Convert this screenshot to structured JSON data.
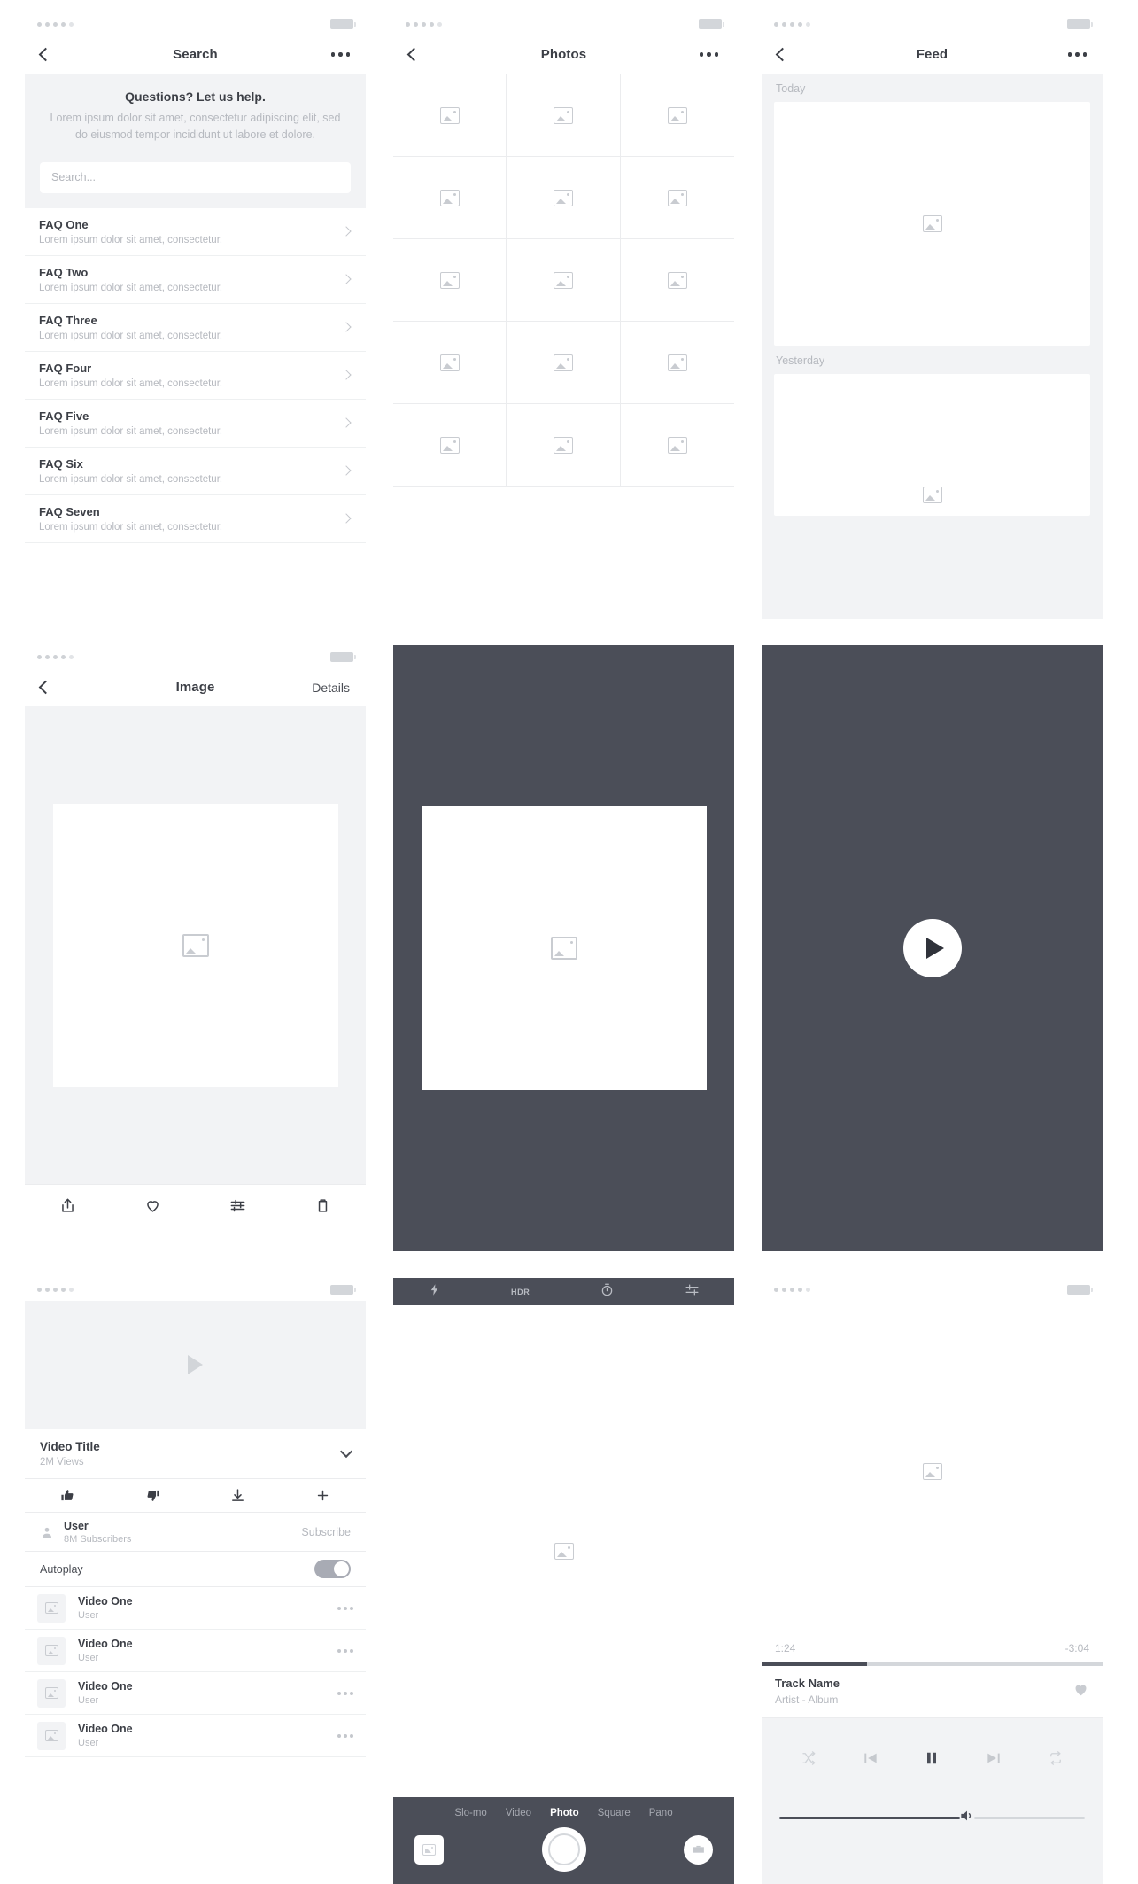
{
  "screens": {
    "search": {
      "nav": {
        "title": "Search",
        "back_icon": "chevron-left-icon",
        "more_icon": "more-horizontal-icon"
      },
      "help": {
        "title": "Questions? Let us help.",
        "body": "Lorem ipsum dolor sit amet, consectetur adipiscing elit, sed do eiusmod tempor incididunt ut labore et dolore."
      },
      "search_placeholder": "Search...",
      "faq": [
        {
          "question": "FAQ One",
          "answer": "Lorem ipsum dolor sit amet, consectetur."
        },
        {
          "question": "FAQ Two",
          "answer": "Lorem ipsum dolor sit amet, consectetur."
        },
        {
          "question": "FAQ Three",
          "answer": "Lorem ipsum dolor sit amet, consectetur."
        },
        {
          "question": "FAQ Four",
          "answer": "Lorem ipsum dolor sit amet, consectetur."
        },
        {
          "question": "FAQ Five",
          "answer": "Lorem ipsum dolor sit amet, consectetur."
        },
        {
          "question": "FAQ Six",
          "answer": "Lorem ipsum dolor sit amet, consectetur."
        },
        {
          "question": "FAQ Seven",
          "answer": "Lorem ipsum dolor sit amet, consectetur."
        }
      ]
    },
    "photos": {
      "nav": {
        "title": "Photos",
        "back_icon": "chevron-left-icon",
        "more_icon": "more-horizontal-icon"
      },
      "cell_count": 15,
      "cell_icon": "image-placeholder-icon"
    },
    "feed": {
      "nav": {
        "title": "Feed",
        "back_icon": "chevron-left-icon",
        "more_icon": "more-horizontal-icon"
      },
      "sections": [
        {
          "label": "Today"
        },
        {
          "label": "Yesterday"
        }
      ],
      "card_icon": "image-placeholder-icon"
    },
    "image_detail": {
      "nav": {
        "title": "Image",
        "back_icon": "chevron-left-icon",
        "right_action": "Details"
      },
      "toolbar": [
        {
          "name": "share-icon",
          "label": "Share"
        },
        {
          "name": "heart-icon",
          "label": "Favorite"
        },
        {
          "name": "adjust-icon",
          "label": "Adjust"
        },
        {
          "name": "trash-icon",
          "label": "Delete"
        }
      ]
    },
    "lightbox": {
      "image_icon": "image-placeholder-icon"
    },
    "video_player": {
      "play_icon": "play-icon"
    },
    "video_detail": {
      "preview_icon": "play-triangle-icon",
      "title": "Video Title",
      "views": "2M Views",
      "collapse_icon": "chevron-down-icon",
      "actions": [
        {
          "name": "thumbs-up-icon",
          "label": "Like"
        },
        {
          "name": "thumbs-down-icon",
          "label": "Dislike"
        },
        {
          "name": "download-icon",
          "label": "Download"
        },
        {
          "name": "plus-icon",
          "label": "Add to"
        }
      ],
      "channel": {
        "name": "User",
        "subscribers": "8M Subscribers",
        "action": "Subscribe",
        "avatar_icon": "person-icon"
      },
      "autoplay": {
        "label": "Autoplay",
        "on": true
      },
      "list": [
        {
          "title": "Video One",
          "user": "User"
        },
        {
          "title": "Video One",
          "user": "User"
        },
        {
          "title": "Video One",
          "user": "User"
        },
        {
          "title": "Video One",
          "user": "User"
        }
      ],
      "list_more_icon": "more-horizontal-icon"
    },
    "camera": {
      "top": [
        {
          "name": "flash-icon",
          "label": ""
        },
        {
          "name": "hdr-label",
          "label": "HDR"
        },
        {
          "name": "timer-icon",
          "label": ""
        },
        {
          "name": "settings-sliders-icon",
          "label": ""
        }
      ],
      "modes": [
        "Slo-mo",
        "Video",
        "Photo",
        "Square",
        "Pano"
      ],
      "active_mode": "Photo",
      "gallery_icon": "image-placeholder-icon",
      "shutter_icon": "shutter-button",
      "flip_icon": "camera-flip-icon"
    },
    "music": {
      "art_icon": "image-placeholder-icon",
      "elapsed": "1:24",
      "remaining": "-3:04",
      "progress_percent": 31,
      "track_name": "Track Name",
      "track_artist": "Artist - Album",
      "favorite_icon": "heart-filled-icon",
      "controls": [
        {
          "name": "shuffle-icon",
          "label": "Shuffle"
        },
        {
          "name": "previous-icon",
          "label": "Previous"
        },
        {
          "name": "pause-icon",
          "label": "Pause"
        },
        {
          "name": "next-icon",
          "label": "Next"
        },
        {
          "name": "repeat-icon",
          "label": "Repeat"
        }
      ],
      "volume_percent": 59,
      "volume_icon": "volume-icon"
    }
  },
  "colors": {
    "dark_surface": "#4b4e58",
    "light_surface": "#f2f3f5",
    "text_primary": "#3c3f46",
    "text_muted": "#b6b9bf",
    "divider": "#ebecee"
  }
}
